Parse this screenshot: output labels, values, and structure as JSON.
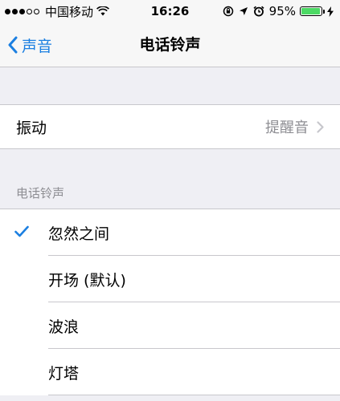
{
  "status_bar": {
    "signal_filled": 3,
    "signal_total": 5,
    "carrier": "中国移动",
    "time": "16:26",
    "battery_text": "95%",
    "battery_level": 0.95,
    "icons": [
      "wifi-icon",
      "orientation-lock-icon",
      "location-arrow-icon",
      "alarm-icon",
      "charging-bolt-icon"
    ]
  },
  "nav": {
    "back_label": "声音",
    "title": "电话铃声"
  },
  "vibration": {
    "label": "振动",
    "value": "提醒音"
  },
  "ringtones": {
    "header": "电话铃声",
    "items": [
      {
        "label": "忽然之间",
        "selected": true
      },
      {
        "label": "开场 (默认)",
        "selected": false
      },
      {
        "label": "波浪",
        "selected": false
      },
      {
        "label": "灯塔",
        "selected": false
      }
    ]
  },
  "colors": {
    "accent": "#1b7fe1",
    "background": "#efeff4",
    "secondary_text": "#8e8e93",
    "battery": "#4cd964"
  }
}
